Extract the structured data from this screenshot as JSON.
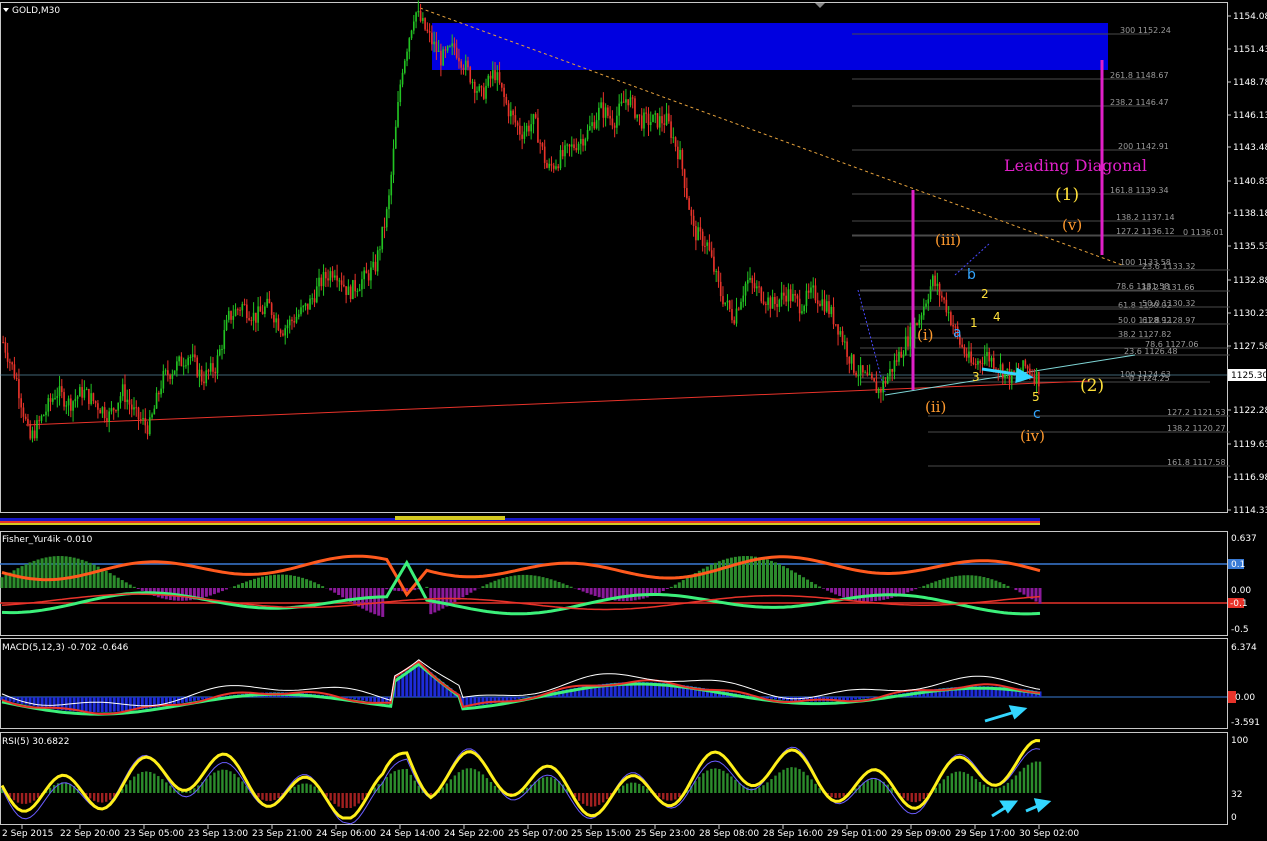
{
  "symbol_label": "GOLD,M30",
  "colors": {
    "background": "#000000",
    "bull_candle": "#22c322",
    "bear_candle": "#e8332a",
    "zone": "#0000e0",
    "support_line": "#e8332a",
    "channel_line": "#7fd6d6",
    "trend_dash": "#e6a23c",
    "vertical_marker": "#e020c8",
    "cyan_arrow": "#33d6ff"
  },
  "price_axis": {
    "ticks": [
      "1154.08",
      "1151.43",
      "1148.78",
      "1146.13",
      "1143.48",
      "1140.83",
      "1138.18",
      "1135.53",
      "1132.88",
      "1130.23",
      "1127.58",
      "1125.30",
      "1122.28",
      "1119.63",
      "1116.98",
      "1114.33"
    ],
    "current_price": "1125.30"
  },
  "time_axis": {
    "labels": [
      "2 Sep 2015",
      "22 Sep 20:00",
      "23 Sep 05:00",
      "23 Sep 13:00",
      "23 Sep 21:00",
      "24 Sep 06:00",
      "24 Sep 14:00",
      "24 Sep 22:00",
      "25 Sep 07:00",
      "25 Sep 15:00",
      "25 Sep 23:00",
      "28 Sep 08:00",
      "28 Sep 16:00",
      "29 Sep 01:00",
      "29 Sep 09:00",
      "29 Sep 17:00",
      "30 Sep 02:00"
    ]
  },
  "fib_levels": [
    "300 1152.24",
    "261.8 1148.67",
    "238.2 1146.47",
    "200 1142.91",
    "161.8 1139.34",
    "138.2 1137.14",
    "127.2 1136.12",
    "0 1136.01",
    "100 1133.58",
    "23.6 1133.32",
    "78.6 1131.58",
    "38.2 1131.66",
    "61.8 1130.02",
    "50.0 1130.32",
    "50.0 1128.92",
    "61.8 1128.97",
    "38.2 1127.82",
    "78.6 1127.06",
    "23.6 1126.48",
    "100 1124.63",
    "0 1124.25",
    "127.2 1121.53",
    "138.2 1120.27",
    "161.8 1117.58"
  ],
  "annotations": {
    "leading_diagonal": "Leading Diagonal",
    "wave_1": "(1)",
    "wave_2": "(2)",
    "wave_i": "(i)",
    "wave_ii": "(ii)",
    "wave_iii": "(iii)",
    "wave_iv": "(iv)",
    "wave_v": "(v)",
    "sub_a": "a",
    "sub_b": "b",
    "sub_c": "c",
    "n1": "1",
    "n2": "2",
    "n3": "3",
    "n4": "4",
    "n5": "5"
  },
  "indicators": {
    "fisher": {
      "title": "Fisher_Yur4ik -0.010",
      "axis": [
        "0.637",
        "0.1",
        "0.00",
        "-0.1",
        "-0.5"
      ]
    },
    "macd": {
      "title": "MACD(5,12,3) -0.702 -0.646",
      "axis": [
        "6.374",
        "0.00",
        "-3.591"
      ]
    },
    "rsi": {
      "title": "RSI(5) 30.6822",
      "axis": [
        "100",
        "32",
        "0"
      ]
    }
  },
  "chart_data": {
    "type": "candlestick",
    "title": "GOLD,M30",
    "ylim": [
      1114.33,
      1155.5
    ],
    "close_path": [
      [
        0,
        1128
      ],
      [
        1,
        1125
      ],
      [
        2,
        1120
      ],
      [
        3,
        1122
      ],
      [
        4,
        1124
      ],
      [
        5,
        1123
      ],
      [
        6,
        1124
      ],
      [
        7,
        1123
      ],
      [
        8,
        1122
      ],
      [
        9,
        1124
      ],
      [
        10,
        1122
      ],
      [
        11,
        1121
      ],
      [
        12,
        1125
      ],
      [
        13,
        1126
      ],
      [
        14,
        1127
      ],
      [
        15,
        1125
      ],
      [
        16,
        1126
      ],
      [
        17,
        1130
      ],
      [
        18,
        1131
      ],
      [
        19,
        1130
      ],
      [
        20,
        1131
      ],
      [
        21,
        1129
      ],
      [
        22,
        1130
      ],
      [
        23,
        1131
      ],
      [
        24,
        1133
      ],
      [
        25,
        1134
      ],
      [
        26,
        1132
      ],
      [
        27,
        1133
      ],
      [
        28,
        1134
      ],
      [
        29,
        1139
      ],
      [
        30,
        1150
      ],
      [
        31,
        1155
      ],
      [
        32,
        1153
      ],
      [
        33,
        1151
      ],
      [
        34,
        1152
      ],
      [
        35,
        1150
      ],
      [
        36,
        1148
      ],
      [
        37,
        1150
      ],
      [
        38,
        1147
      ],
      [
        39,
        1145
      ],
      [
        40,
        1146
      ],
      [
        41,
        1142
      ],
      [
        42,
        1143
      ],
      [
        43,
        1144
      ],
      [
        44,
        1145
      ],
      [
        45,
        1147
      ],
      [
        46,
        1146
      ],
      [
        47,
        1148
      ],
      [
        48,
        1146
      ],
      [
        49,
        1146
      ],
      [
        50,
        1146
      ],
      [
        51,
        1143
      ],
      [
        52,
        1137
      ],
      [
        53,
        1136
      ],
      [
        54,
        1132
      ],
      [
        55,
        1130
      ],
      [
        56,
        1133
      ],
      [
        57,
        1132
      ],
      [
        58,
        1131
      ],
      [
        59,
        1132
      ],
      [
        60,
        1131
      ],
      [
        61,
        1132
      ],
      [
        62,
        1131
      ],
      [
        63,
        1129
      ],
      [
        64,
        1126
      ],
      [
        65,
        1125
      ],
      [
        66,
        1124
      ],
      [
        67,
        1126
      ],
      [
        68,
        1128
      ],
      [
        69,
        1130
      ],
      [
        70,
        1133
      ],
      [
        71,
        1131
      ],
      [
        72,
        1128
      ],
      [
        73,
        1126
      ],
      [
        74,
        1127
      ],
      [
        75,
        1126
      ],
      [
        76,
        1125
      ],
      [
        77,
        1126
      ],
      [
        78,
        1125
      ]
    ]
  }
}
